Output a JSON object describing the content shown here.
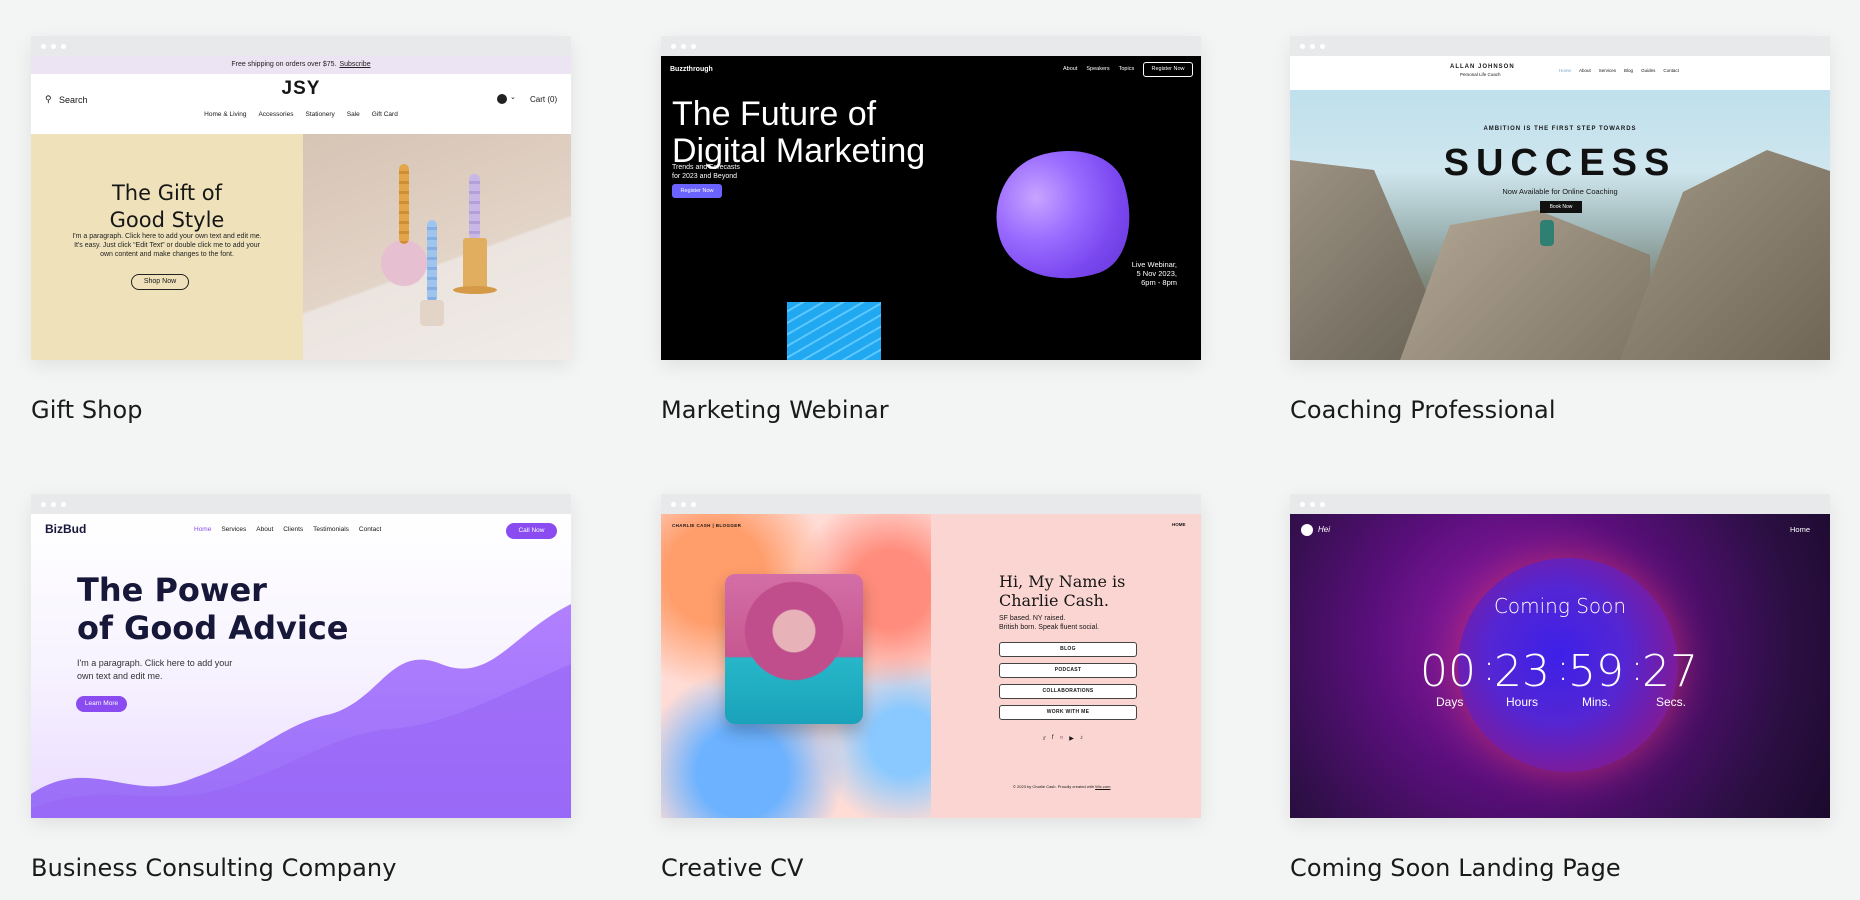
{
  "cards": [
    {
      "caption": "Gift Shop"
    },
    {
      "caption": "Marketing Webinar"
    },
    {
      "caption": "Coaching Professional"
    },
    {
      "caption": "Business Consulting Company"
    },
    {
      "caption": "Creative CV"
    },
    {
      "caption": "Coming Soon Landing Page"
    }
  ],
  "gift_shop": {
    "banner": "Free shipping on orders over $75.",
    "banner_link": "Subscribe",
    "search": "Search",
    "brand": "JSY",
    "cart": "Cart (0)",
    "nav": [
      "Home & Living",
      "Accessories",
      "Stationery",
      "Sale",
      "Gift Card"
    ],
    "title_line1": "The Gift of",
    "title_line2": "Good Style",
    "paragraph": "I'm a paragraph. Click here to add your own text and edit me. It's easy. Just click “Edit Text” or double click me to add your own content and make changes to the font.",
    "button": "Shop Now"
  },
  "webinar": {
    "brand": "Buzzthrough",
    "nav": [
      "About",
      "Speakers",
      "Topics"
    ],
    "register_top": "Register Now",
    "title_line1": "The Future of",
    "title_line2": "Digital Marketing",
    "sub_line1": "Trends and Forecasts",
    "sub_line2": "for 2023 and Beyond",
    "button": "Register Now",
    "live_line1": "Live Webinar,",
    "live_line2": "5 Nov 2023,",
    "live_line3": "6pm - 8pm"
  },
  "coaching": {
    "name": "ALLAN JOHNSON",
    "role": "Personal Life Coach",
    "nav": [
      "Home",
      "About",
      "Services",
      "Blog",
      "Guides",
      "Contact"
    ],
    "kicker": "AMBITION IS THE FIRST STEP TOWARDS",
    "headline": "SUCCESS",
    "sub": "Now Available for Online Coaching",
    "button": "Book Now"
  },
  "consulting": {
    "brand": "BizBud",
    "nav": [
      "Home",
      "Services",
      "About",
      "Clients",
      "Testimonials",
      "Contact"
    ],
    "cta": "Call Now",
    "title_line1": "The Power",
    "title_line2": "of Good Advice",
    "paragraph_line1": "I'm a paragraph. Click here to add your",
    "paragraph_line2": "own text and edit me.",
    "button": "Learn More"
  },
  "cv": {
    "header": "CHARLIE CASH | BLOGGER",
    "home": "HOME",
    "name_line1": "Hi, My Name is",
    "name_line2": "Charlie Cash.",
    "bio_line1": "SF based. NY raised.",
    "bio_line2": "British born. Speak fluent social.",
    "buttons": [
      "BLOG",
      "PODCAST",
      "COLLABORATIONS",
      "WORK WITH ME"
    ],
    "footer": "© 2023 by Charlie Cash. Proudly created with",
    "footer_link": "Wix.com"
  },
  "coming_soon": {
    "logo": "Hei",
    "nav_home": "Home",
    "title": "Coming Soon",
    "days": "00",
    "hours": "23",
    "mins": "59",
    "secs": "27",
    "sep": ":",
    "labels": [
      "Days",
      "Hours",
      "Mins.",
      "Secs."
    ]
  },
  "colors": {
    "page_bg": "#f3f4f4",
    "accent_purple": "#8a4cf0",
    "webinar_blue": "#6a63ff"
  }
}
